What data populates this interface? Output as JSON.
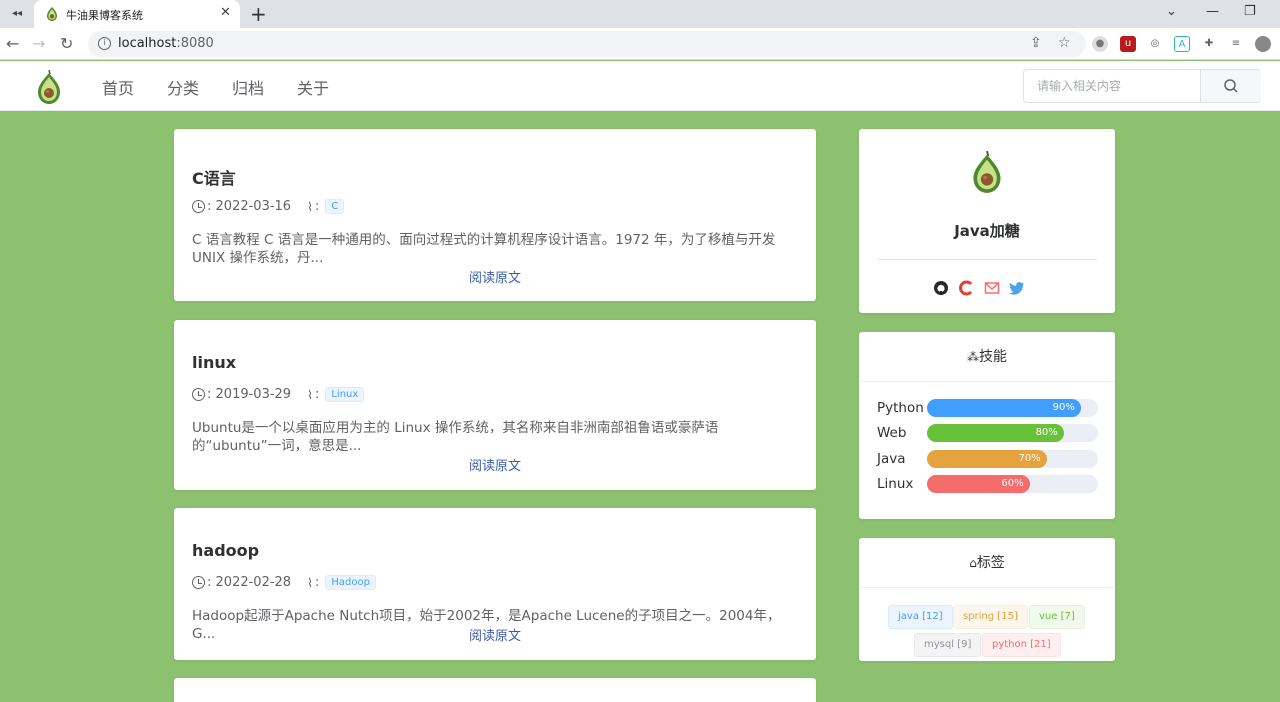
{
  "browser": {
    "tab_title": "牛油果博客系统",
    "url_host": "localhost",
    "url_port": ":8080"
  },
  "site": {
    "nav": [
      "首页",
      "分类",
      "归档",
      "关于"
    ],
    "search_placeholder": "请输入相关内容"
  },
  "posts": [
    {
      "title": "C语言",
      "date": "2022-03-16",
      "tag": "C",
      "summary": "C 语言教程 C 语言是一种通用的、面向过程式的计算机程序设计语言。1972 年，为了移植与开发 UNIX 操作系统，丹...",
      "read_more": "阅读原文"
    },
    {
      "title": "linux",
      "date": "2019-03-29",
      "tag": "Linux",
      "summary": "Ubuntu是一个以桌面应用为主的 Linux 操作系统，其名称来自非洲南部祖鲁语或豪萨语的“ubuntu”一词，意思是...",
      "read_more": "阅读原文"
    },
    {
      "title": "hadoop",
      "date": "2022-02-28",
      "tag": "Hadoop",
      "summary": "Hadoop起源于Apache Nutch项目，始于2002年，是Apache Lucene的子项目之一。2004年，G...",
      "read_more": "阅读原文"
    }
  ],
  "meta_sep": ":",
  "profile": {
    "name": "Java加糖"
  },
  "skills": {
    "title": "技能",
    "items": [
      {
        "name": "Python",
        "percent": 90,
        "label": "90%",
        "color": "#409eff"
      },
      {
        "name": "Web",
        "percent": 80,
        "label": "80%",
        "color": "#67c23a"
      },
      {
        "name": "Java",
        "percent": 70,
        "label": "70%",
        "color": "#e6a23c"
      },
      {
        "name": "Linux",
        "percent": 60,
        "label": "60%",
        "color": "#f56c6c"
      }
    ]
  },
  "tags": {
    "title": "标签",
    "items": [
      {
        "label": "java [12]",
        "bg": "#ecf5ff",
        "fg": "#409eff",
        "bd": "#d9ecff"
      },
      {
        "label": "spring [15]",
        "bg": "#fdf6ec",
        "fg": "#e6a23c",
        "bd": "#faecd8"
      },
      {
        "label": "vue [7]",
        "bg": "#f0f9eb",
        "fg": "#67c23a",
        "bd": "#e1f3d8"
      },
      {
        "label": "mysql [9]",
        "bg": "#f4f4f5",
        "fg": "#909399",
        "bd": "#e9e9eb"
      },
      {
        "label": "python [21]",
        "bg": "#fef0f0",
        "fg": "#f56c6c",
        "bd": "#fde2e2"
      }
    ]
  },
  "colors": {
    "page_bg": "#8cc26f",
    "link": "#3b5cab"
  }
}
